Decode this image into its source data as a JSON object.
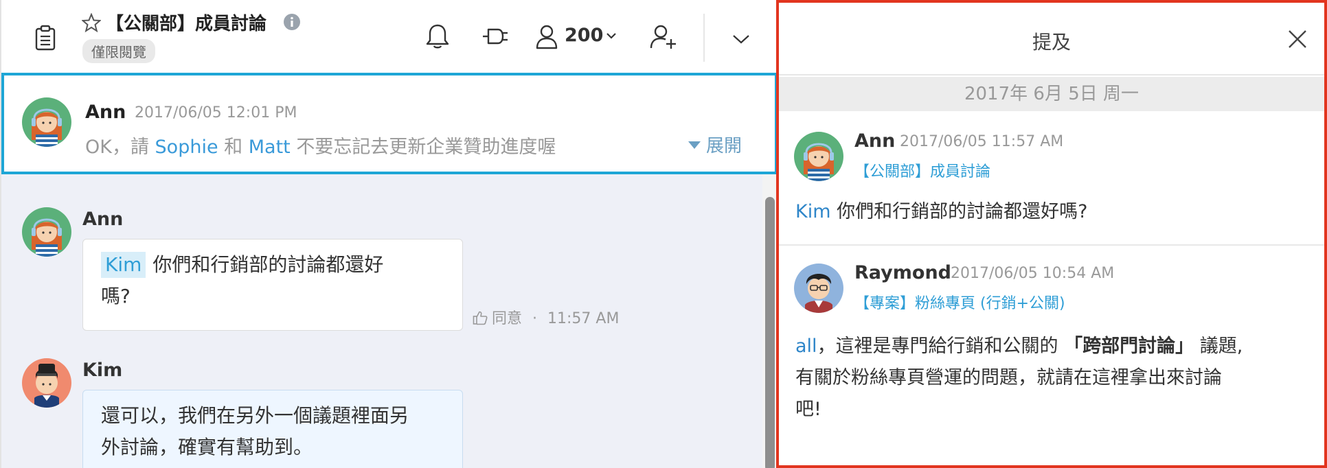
{
  "header": {
    "group_title": "【公關部】成員討論",
    "readonly_badge": "僅限閱覽",
    "member_count": "200"
  },
  "pinned_message": {
    "sender": "Ann",
    "timestamp": "2017/06/05 12:01 PM",
    "text_before": "OK，請 ",
    "mention_1": "Sophie",
    "text_middle": " 和 ",
    "mention_2": "Matt",
    "text_after": " 不要忘記去更新企業贊助進度喔",
    "expand_label": "展開"
  },
  "messages": [
    {
      "sender": "Ann",
      "mention": "Kim",
      "text_line1": "你們和行銷部的討論都還好",
      "text_line2": "嗎?",
      "agree_label": "同意",
      "separator": "·",
      "time": "11:57 AM"
    },
    {
      "sender": "Kim",
      "text_line1": "還可以，我們在另外一個議題裡面另",
      "text_line2": "外討論，確實有幫助到。"
    }
  ],
  "mentions_panel": {
    "title": "提及",
    "date_label": "2017年 6月 5日 周一",
    "items": [
      {
        "sender": "Ann",
        "timestamp": "2017/06/05 11:57 AM",
        "channel": "【公關部】成員討論",
        "mention": "Kim",
        "text": " 你們和行銷部的討論都還好嗎?"
      },
      {
        "sender": "Raymond",
        "timestamp": "2017/06/05 10:54 AM",
        "channel": "【專案】粉絲專頁 (行銷+公關)",
        "mention": "all",
        "text_before": "，這裡是專門給行銷和公關的 ",
        "emphasis": "「跨部門討論」",
        "text_after": " 議題,",
        "text_line2": "有關於粉絲專頁營運的問題，就請在這裡拿出來討論",
        "text_line3": "吧!"
      }
    ]
  },
  "colors": {
    "pinned_border": "#1ea6d6",
    "panel_border": "#e2351f",
    "mention_blue": "#2f9ed6",
    "chat_background": "#eef0f7"
  },
  "icons": [
    "clipboard-icon",
    "star-icon",
    "info-icon",
    "bell-icon",
    "plug-icon",
    "person-icon",
    "chevron-down-icon",
    "add-user-icon",
    "thumbs-up-icon",
    "close-icon"
  ]
}
